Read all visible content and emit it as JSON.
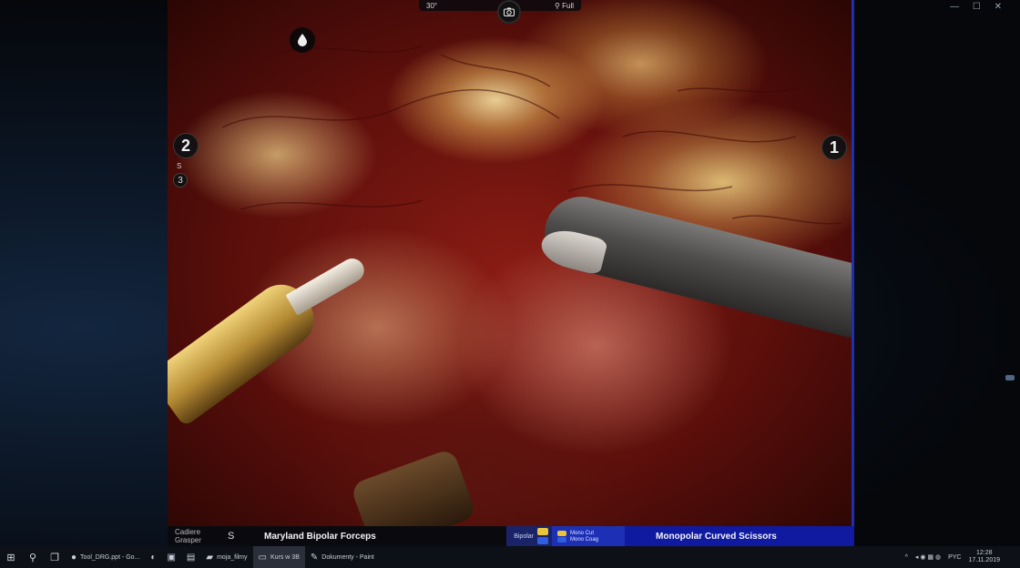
{
  "window": {
    "topright_icons": "— ☐ ✕"
  },
  "video": {
    "top_bar": {
      "zoom": "30°",
      "mode": "Full"
    },
    "camera_icon": "camera-icon",
    "drop_icon": "drop-icon",
    "arms": {
      "arm_2": "2",
      "arm_2_sub": "S",
      "arm_3": "3",
      "arm_1": "1"
    }
  },
  "console": {
    "left_arm_name": "Cadiere Grasper",
    "left_arm_number": "S",
    "left_tool": "Maryland Bipolar Forceps",
    "energy_label": "Bipolar",
    "pedal_yellow_label": "Mono Cut",
    "pedal_blue_label": "Mono Coag",
    "right_tool": "Monopolar Curved Scissors",
    "colors": {
      "yellow": "#e8c53a",
      "blue": "#2f5fe0",
      "panel": "#1d2fb5"
    }
  },
  "taskbar": {
    "start_icon": "⊞",
    "search_icon": "⚲",
    "taskview_icon": "❐",
    "apps": [
      {
        "label": "Tool_DRG.ppt - Go...",
        "glyph": "●",
        "active": false
      },
      {
        "label": "",
        "glyph": "◐",
        "active": false
      },
      {
        "label": "",
        "glyph": "▣",
        "active": false
      },
      {
        "label": "",
        "glyph": "▤",
        "active": false
      },
      {
        "label": "moja_filmy",
        "glyph": "▰",
        "active": false
      },
      {
        "label": "Kurs w 3B",
        "glyph": "▭",
        "active": true
      },
      {
        "label": "Dokumenty - Paint",
        "glyph": "✎",
        "active": false
      }
    ],
    "tray": {
      "chevron": "^",
      "icons": "◂ ◉ ▦ ◍",
      "lang": "PYC",
      "time": "12:28",
      "date": "17.11.2019"
    }
  }
}
